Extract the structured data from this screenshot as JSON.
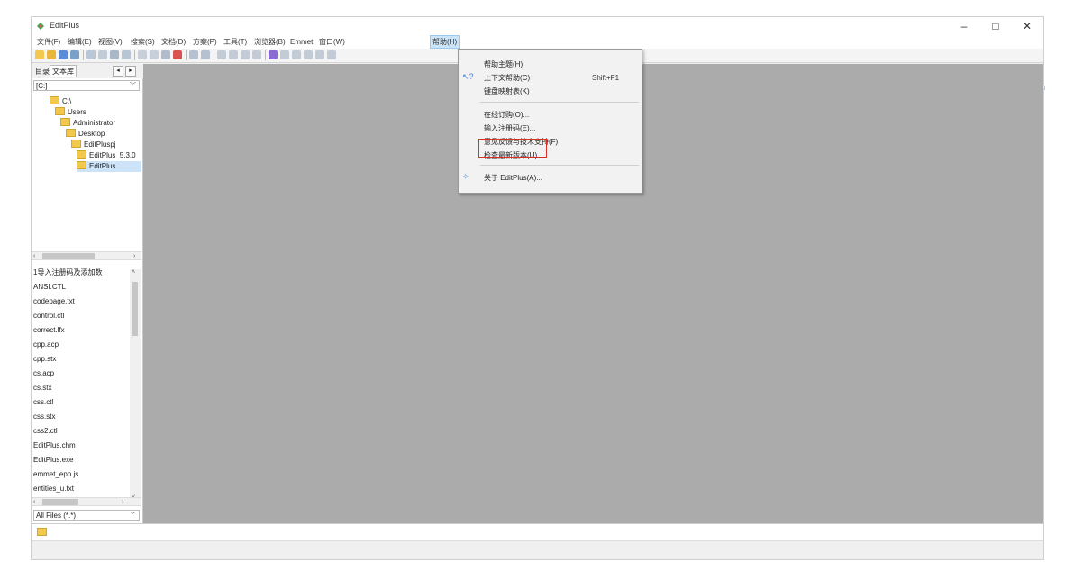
{
  "window": {
    "title": "EditPlus",
    "minimize": "–",
    "maximize": "□",
    "close": "✕",
    "accent": "#cde3f7",
    "app_icon": "editplus-logo-icon"
  },
  "menubar": {
    "file": "文件(F)",
    "edit": "编辑(E)",
    "view": "视图(V)",
    "search": "搜索(S)",
    "document": "文档(D)",
    "project": "方案(P)",
    "tools": "工具(T)",
    "browser": "浏览器(B)",
    "emmet": "Emmet",
    "window": "窗口(W)",
    "help": "帮助(H)"
  },
  "sidebar": {
    "tab_directory": "目录",
    "tab_cliptext": "文本库",
    "drive": "[C:]",
    "tree": [
      {
        "label": "C:\\"
      },
      {
        "label": "Users"
      },
      {
        "label": "Administrator"
      },
      {
        "label": "Desktop"
      },
      {
        "label": "EditPluspj"
      },
      {
        "label": "EditPlus_5.3.0"
      },
      {
        "label": "EditPlus"
      }
    ],
    "files": [
      "1导入注册码及添加数",
      "ANSI.CTL",
      "codepage.txt",
      "control.ctl",
      "correct.lfx",
      "cpp.acp",
      "cpp.stx",
      "cs.acp",
      "cs.stx",
      "css.ctl",
      "css.stx",
      "css2.ctl",
      "EditPlus.chm",
      "EditPlus.exe",
      "emmet_epp.js",
      "entities_u.txt"
    ],
    "filter": "All Files (*.*)"
  },
  "help_menu": {
    "items": [
      {
        "label": "帮助主题(H)",
        "shortcut": ""
      },
      {
        "label": "上下文帮助(C)",
        "shortcut": "Shift+F1"
      },
      {
        "label": "键盘映射表(K)",
        "shortcut": ""
      },
      {
        "label": "在线订购(O)...",
        "shortcut": ""
      },
      {
        "label": "输入注册码(E)...",
        "shortcut": ""
      },
      {
        "label": "意见反馈与技术支持(F)",
        "shortcut": ""
      },
      {
        "label": "检查最新版本(U)",
        "shortcut": ""
      },
      {
        "label": "关于 EditPlus(A)...",
        "shortcut": ""
      }
    ],
    "highlighted_item": "输入注册码(E)...",
    "highlight_color": "#d9302a"
  }
}
